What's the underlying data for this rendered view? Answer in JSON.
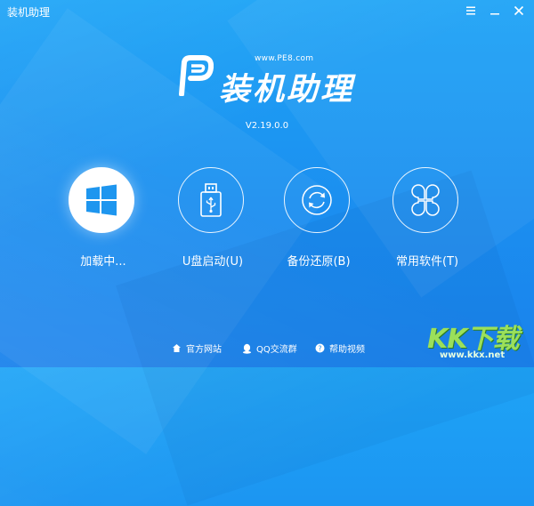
{
  "window": {
    "title": "装机助理"
  },
  "logo": {
    "url": "www.PE8.com",
    "text": "装机助理"
  },
  "version": "V2.19.0.0",
  "actions": [
    {
      "label": "加载中...",
      "icon": "windows-icon"
    },
    {
      "label": "U盘启动(U)",
      "icon": "usb-drive-icon"
    },
    {
      "label": "备份还原(B)",
      "icon": "backup-restore-icon"
    },
    {
      "label": "常用软件(T)",
      "icon": "clover-icon"
    }
  ],
  "footer": {
    "links": [
      {
        "label": "官方网站",
        "icon": "home-icon"
      },
      {
        "label": "QQ交流群",
        "icon": "qq-penguin-icon"
      },
      {
        "label": "帮助视频",
        "icon": "help-icon"
      }
    ]
  },
  "watermark": {
    "text": "KK下载",
    "url": "www.kkx.net"
  },
  "colors": {
    "background": "#1b8ff0",
    "accent": "#1a82ec",
    "windows_blue": "#1e96ef"
  }
}
